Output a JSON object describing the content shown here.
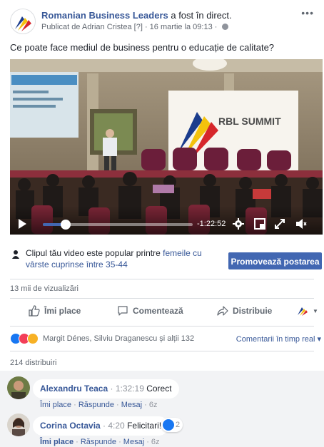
{
  "post": {
    "page_name": "Romanian Business Leaders",
    "action": " a fost în direct.",
    "published_prefix": "Publicat de Adrian Cristea",
    "published_help": "[?]",
    "published_date": "· 16 martie la 09:13 ·",
    "more": "•••",
    "text": "Ce poate face mediul de business pentru o educație de calitate?"
  },
  "video": {
    "banner_title": "RBL SUMMIT",
    "time_remaining": "-1:22:52",
    "progress": 0.15,
    "icons": [
      "play-icon",
      "settings-icon",
      "fullscreen-icon",
      "expand-icon",
      "volume-icon"
    ]
  },
  "promo": {
    "text_prefix": "Clipul tău video este popular printre ",
    "text_link": "femeile cu vârste cuprinse între 35-44",
    "button": "Promovează postarea"
  },
  "stats": {
    "views": "13 mii de vizualizări",
    "shares": "214 distribuiri"
  },
  "actions": {
    "like": "Îmi place",
    "comment": "Comentează",
    "share": "Distribuie"
  },
  "reactions": {
    "names": "Margit Dénes, Silviu Draganescu și alții 132",
    "live_comments": "Comentarii în timp real ▾"
  },
  "comments": [
    {
      "name": "Alexandru Teaca",
      "time": "· 1:32:19",
      "text": "Corect",
      "like": "Îmi place",
      "reply": "Răspunde",
      "message": "Mesaj",
      "age": "6z"
    },
    {
      "name": "Corina Octavia",
      "time": "· 4:20",
      "text": "Felicitari!",
      "like": "Îmi place",
      "reply": "Răspunde",
      "message": "Mesaj",
      "age": "6z",
      "likes": "2"
    }
  ],
  "colors": {
    "accent": "#4267b2",
    "link": "#385898"
  }
}
